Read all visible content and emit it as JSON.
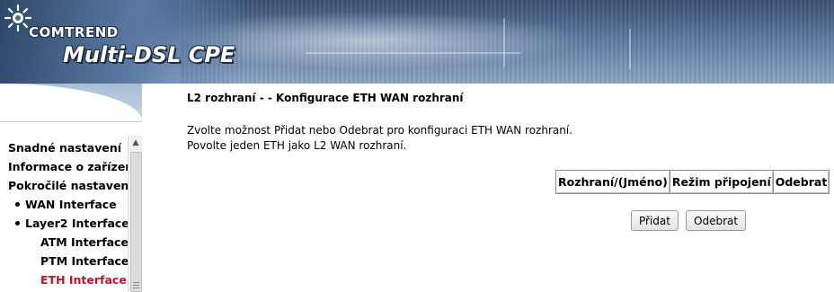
{
  "header": {
    "brand": "COMTREND",
    "product": "Multi-DSL CPE"
  },
  "sidebar": {
    "items": [
      {
        "label": "Snadné nastavení",
        "level": 0,
        "active": false
      },
      {
        "label": "Informace o zařízení",
        "level": 0,
        "active": false
      },
      {
        "label": "Pokročilé nastavení",
        "level": 0,
        "active": false
      },
      {
        "label": "WAN Interface",
        "level": 1,
        "active": false
      },
      {
        "label": "Layer2 Interface",
        "level": 1,
        "active": false
      },
      {
        "label": "ATM Interface",
        "level": 2,
        "active": false
      },
      {
        "label": "PTM Interface",
        "level": 2,
        "active": false
      },
      {
        "label": "ETH Interface",
        "level": 2,
        "active": true
      }
    ],
    "scroll_up_icon": "triangle-up",
    "active_color": "#c8102e"
  },
  "main": {
    "title": "L2 rozhraní - - Konfigurace ETH WAN rozhraní",
    "description_1": "Zvolte možnost Přidat nebo Odebrat pro konfiguraci ETH WAN rozhraní.",
    "description_2": "Povolte jeden ETH jako L2 WAN rozhraní.",
    "table": {
      "columns": [
        "Rozhraní/(Jméno)",
        "Režim připojení",
        "Odebrat"
      ]
    },
    "buttons": {
      "add": "Přidat",
      "remove": "Odebrat"
    }
  }
}
